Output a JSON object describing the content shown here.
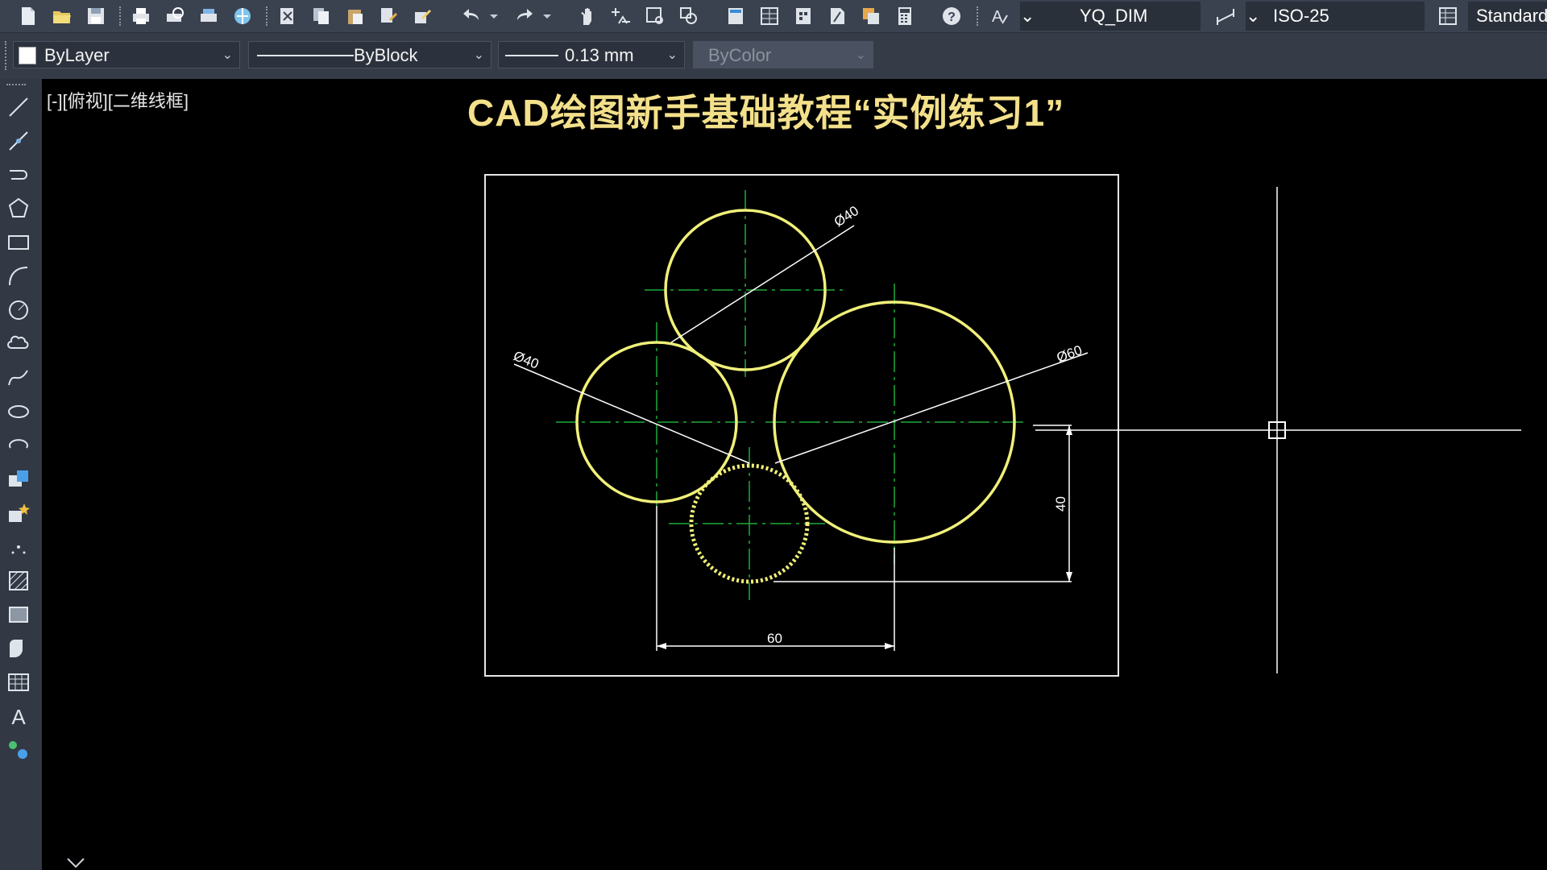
{
  "toolbar": {
    "dimstyle_value": "YQ_DIM",
    "scale_value": "ISO-25",
    "tablestyle_value": "Standard"
  },
  "properties": {
    "color_value": "ByLayer",
    "linetype_value": "ByBlock",
    "lineweight_value": "0.13 mm",
    "plotstyle_value": "ByColor"
  },
  "viewport": {
    "label": "[-][俯视][二维线框]"
  },
  "title": "CAD绘图新手基础教程“实例练习1”",
  "drawing": {
    "dim_top": "Ø40",
    "dim_left": "Ø40",
    "dim_right": "Ø60",
    "dim_vertical": "40",
    "dim_horizontal": "60"
  },
  "colors": {
    "circle": "#f0f07a",
    "center_line": "#1faa3a",
    "dim_line": "#ffffff"
  },
  "icons": {
    "toolbar": [
      "new-icon",
      "open-icon",
      "save-icon",
      "print-icon",
      "preview-icon",
      "plot-icon",
      "publish-icon",
      "cut-icon",
      "copy-icon",
      "paste-icon",
      "match-icon",
      "brush-icon",
      "undo-icon",
      "redo-icon",
      "pan-icon",
      "zoom-realtime-icon",
      "zoom-window-icon",
      "zoom-prev-icon",
      "properties-icon",
      "design-center-icon",
      "tool-palette-icon",
      "sheet-set-icon",
      "markup-icon",
      "calculator-icon",
      "help-icon",
      "text-style-icon",
      "dim-style-icon",
      "table-style-icon"
    ],
    "left": [
      "line-icon",
      "construction-line-icon",
      "polyline-icon",
      "polygon-icon",
      "rectangle-icon",
      "arc-icon",
      "circle-icon",
      "revcloud-icon",
      "spline-icon",
      "ellipse-icon",
      "ellipse-arc-icon",
      "insert-block-icon",
      "make-block-icon",
      "point-icon",
      "hatch-icon",
      "gradient-icon",
      "region-icon",
      "table-icon",
      "mtext-icon",
      "add-selected-icon"
    ]
  }
}
